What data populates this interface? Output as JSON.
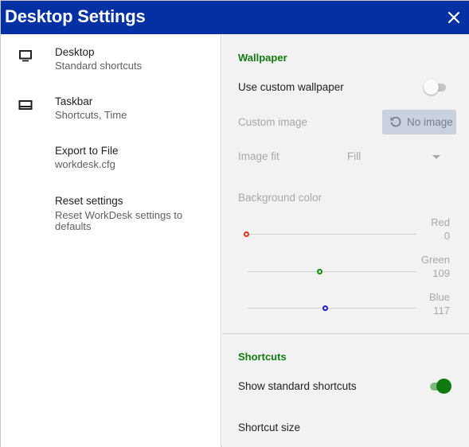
{
  "window": {
    "title": "Desktop Settings"
  },
  "sidebar": {
    "items": [
      {
        "label": "Desktop",
        "sub": "Standard shortcuts",
        "icon": "monitor-icon"
      },
      {
        "label": "Taskbar",
        "sub": "Shortcuts, Time",
        "icon": "taskbar-icon"
      },
      {
        "label": "Export to File",
        "sub": "workdesk.cfg"
      },
      {
        "label": "Reset settings",
        "sub": "Reset WorkDesk settings to defaults"
      }
    ]
  },
  "wallpaper": {
    "section_title": "Wallpaper",
    "custom_label": "Use custom wallpaper",
    "custom_enabled": false,
    "image_label": "Custom image",
    "image_button": "No image",
    "fit_label": "Image fit",
    "fit_value": "Fill",
    "bg_label": "Background color",
    "sliders": [
      {
        "name": "Red",
        "value": "0",
        "color": "#e0301e"
      },
      {
        "name": "Green",
        "value": "109",
        "color": "#118a11"
      },
      {
        "name": "Blue",
        "value": "117",
        "color": "#1a1ad0"
      }
    ]
  },
  "shortcuts": {
    "section_title": "Shortcuts",
    "show_label": "Show standard shortcuts",
    "show_enabled": true,
    "size_label": "Shortcut size"
  },
  "colors": {
    "title_bar": "#0330a3",
    "accent_green": "#117a11"
  }
}
